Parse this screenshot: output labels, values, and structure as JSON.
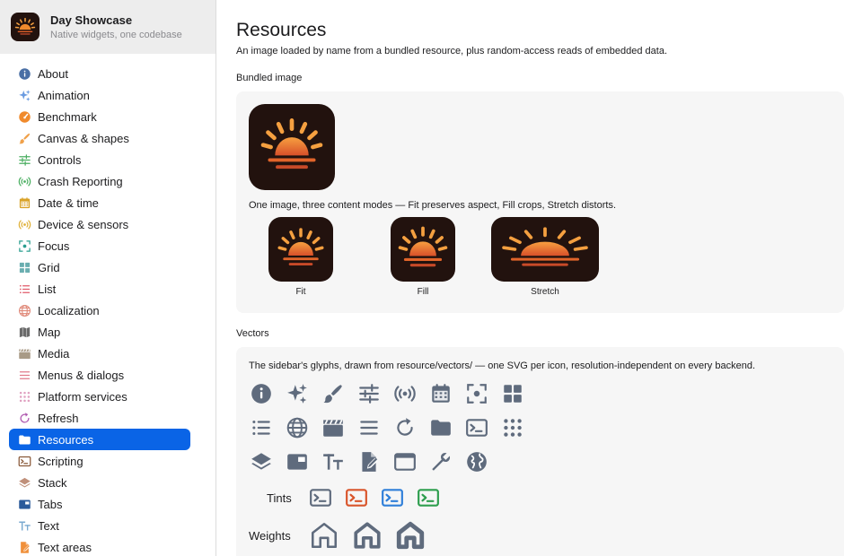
{
  "app": {
    "title": "Day Showcase",
    "subtitle": "Native widgets, one codebase"
  },
  "sidebar": {
    "items": [
      {
        "label": "About",
        "icon": "info-icon",
        "color": "#4a6fa5"
      },
      {
        "label": "Animation",
        "icon": "sparkles-icon",
        "color": "#6a9be0"
      },
      {
        "label": "Benchmark",
        "icon": "gauge-icon",
        "color": "#f08a2c"
      },
      {
        "label": "Canvas & shapes",
        "icon": "brush-icon",
        "color": "#f0a14a"
      },
      {
        "label": "Controls",
        "icon": "sliders-icon",
        "color": "#4caf62"
      },
      {
        "label": "Crash Reporting",
        "icon": "broadcast-icon",
        "color": "#4caf62"
      },
      {
        "label": "Date & time",
        "icon": "calendar-icon",
        "color": "#d9a227"
      },
      {
        "label": "Device & sensors",
        "icon": "sensor-icon",
        "color": "#e0b13a"
      },
      {
        "label": "Focus",
        "icon": "focus-icon",
        "color": "#2a9d8f"
      },
      {
        "label": "Grid",
        "icon": "grid-icon",
        "color": "#6aaeb0"
      },
      {
        "label": "List",
        "icon": "list-icon",
        "color": "#e05a6a"
      },
      {
        "label": "Localization",
        "icon": "globe-icon",
        "color": "#e08a7a"
      },
      {
        "label": "Map",
        "icon": "map-icon",
        "color": "#6b6b6b"
      },
      {
        "label": "Media",
        "icon": "clapper-icon",
        "color": "#a89a86"
      },
      {
        "label": "Menus & dialogs",
        "icon": "menu-icon",
        "color": "#e07a8a"
      },
      {
        "label": "Platform services",
        "icon": "dots-grid-icon",
        "color": "#e0a0c0"
      },
      {
        "label": "Refresh",
        "icon": "refresh-icon",
        "color": "#b05ab0"
      },
      {
        "label": "Resources",
        "icon": "folder-icon",
        "color": "#ffffff",
        "active": true
      },
      {
        "label": "Scripting",
        "icon": "terminal-icon",
        "color": "#8a5a3a"
      },
      {
        "label": "Stack",
        "icon": "layers-icon",
        "color": "#c0907a"
      },
      {
        "label": "Tabs",
        "icon": "tabs-icon",
        "color": "#2a5a9a"
      },
      {
        "label": "Text",
        "icon": "text-icon",
        "color": "#7aaad0"
      },
      {
        "label": "Text areas",
        "icon": "doc-edit-icon",
        "color": "#f0903a"
      }
    ]
  },
  "main": {
    "title": "Resources",
    "description": "An image loaded by name from a bundled resource, plus random-access reads of embedded data.",
    "bundled": {
      "section_label": "Bundled image",
      "caption": "One image, three content modes — Fit preserves aspect, Fill crops, Stretch distorts.",
      "modes": [
        {
          "label": "Fit"
        },
        {
          "label": "Fill"
        },
        {
          "label": "Stretch"
        }
      ]
    },
    "vectors": {
      "section_label": "Vectors",
      "caption": "The sidebar's glyphs, drawn from resource/vectors/ — one SVG per icon, resolution-independent on every backend.",
      "tints_label": "Tints",
      "weights_label": "Weights",
      "glyph_color": "#5f6b7d",
      "tint_colors": [
        "#5f6b7d",
        "#d9552b",
        "#2f7fd9",
        "#2e9e4e"
      ],
      "rows": [
        [
          "info-icon",
          "sparkles-icon",
          "brush-icon",
          "sliders-icon",
          "broadcast-icon",
          "calendar-icon",
          "focus-icon",
          "grid-icon"
        ],
        [
          "list-icon",
          "globe-icon",
          "clapper-icon",
          "menu-icon",
          "refresh-icon",
          "folder-icon",
          "terminal-icon",
          "dots-grid-icon"
        ],
        [
          "layers-icon",
          "tabs-icon",
          "text-icon",
          "doc-edit-icon",
          "window-icon",
          "wrench-icon",
          "world-icon"
        ]
      ]
    }
  }
}
